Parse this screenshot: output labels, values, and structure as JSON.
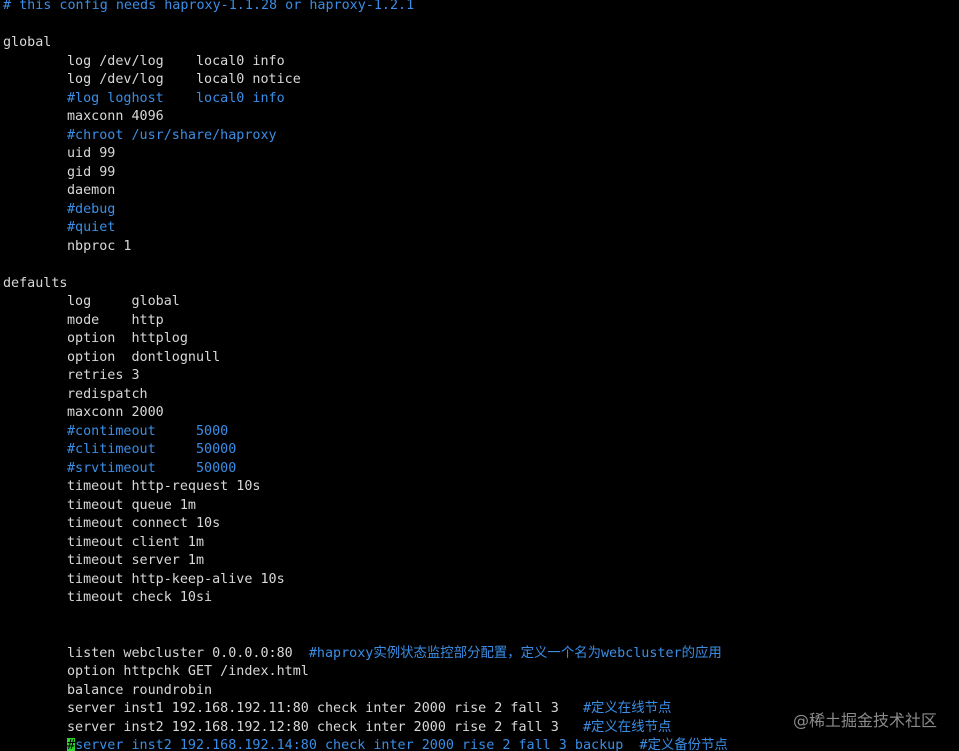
{
  "terminal": {
    "colors": {
      "background": "#000000",
      "text": "#d8d8d8",
      "comment": "#3a8ee6",
      "cursor": "#2fd32f"
    },
    "lines": [
      {
        "text": "# this config needs haproxy-1.1.28 or haproxy-1.2.1",
        "comment": "",
        "indent": 0
      },
      {
        "text": "",
        "comment": "",
        "indent": 0
      },
      {
        "text": "global",
        "comment": "",
        "indent": 0
      },
      {
        "text": "log /dev/log    local0 info",
        "comment": "",
        "indent": 1
      },
      {
        "text": "log /dev/log    local0 notice",
        "comment": "",
        "indent": 1
      },
      {
        "text": "#log loghost    local0 info",
        "comment": "",
        "indent": 1
      },
      {
        "text": "maxconn 4096",
        "comment": "",
        "indent": 1
      },
      {
        "text": "#chroot /usr/share/haproxy",
        "comment": "",
        "indent": 1
      },
      {
        "text": "uid 99",
        "comment": "",
        "indent": 1
      },
      {
        "text": "gid 99",
        "comment": "",
        "indent": 1
      },
      {
        "text": "daemon",
        "comment": "",
        "indent": 1
      },
      {
        "text": "#debug",
        "comment": "",
        "indent": 1
      },
      {
        "text": "#quiet",
        "comment": "",
        "indent": 1
      },
      {
        "text": "nbproc 1",
        "comment": "",
        "indent": 1
      },
      {
        "text": "",
        "comment": "",
        "indent": 0
      },
      {
        "text": "defaults",
        "comment": "",
        "indent": 0
      },
      {
        "text": "log     global",
        "comment": "",
        "indent": 1
      },
      {
        "text": "mode    http",
        "comment": "",
        "indent": 1
      },
      {
        "text": "option  httplog",
        "comment": "",
        "indent": 1
      },
      {
        "text": "option  dontlognull",
        "comment": "",
        "indent": 1
      },
      {
        "text": "retries 3",
        "comment": "",
        "indent": 1
      },
      {
        "text": "redispatch",
        "comment": "",
        "indent": 1
      },
      {
        "text": "maxconn 2000",
        "comment": "",
        "indent": 1
      },
      {
        "text": "#contimeout     5000",
        "comment": "",
        "indent": 1
      },
      {
        "text": "#clitimeout     50000",
        "comment": "",
        "indent": 1
      },
      {
        "text": "#srvtimeout     50000",
        "comment": "",
        "indent": 1
      },
      {
        "text": "timeout http-request 10s",
        "comment": "",
        "indent": 1
      },
      {
        "text": "timeout queue 1m",
        "comment": "",
        "indent": 1
      },
      {
        "text": "timeout connect 10s",
        "comment": "",
        "indent": 1
      },
      {
        "text": "timeout client 1m",
        "comment": "",
        "indent": 1
      },
      {
        "text": "timeout server 1m",
        "comment": "",
        "indent": 1
      },
      {
        "text": "timeout http-keep-alive 10s",
        "comment": "",
        "indent": 1
      },
      {
        "text": "timeout check 10si",
        "comment": "",
        "indent": 1
      },
      {
        "text": "",
        "comment": "",
        "indent": 0
      },
      {
        "text": "",
        "comment": "",
        "indent": 0
      },
      {
        "text": "listen webcluster 0.0.0.0:80  ",
        "comment": "#haproxy实例状态监控部分配置，定义一个名为webcluster的应用",
        "indent": 1
      },
      {
        "text": "option httpchk GET /index.html",
        "comment": "",
        "indent": 1
      },
      {
        "text": "balance roundrobin",
        "comment": "",
        "indent": 1
      },
      {
        "text": "server inst1 192.168.192.11:80 check inter 2000 rise 2 fall 3   ",
        "comment": "#定义在线节点",
        "indent": 1
      },
      {
        "text": "server inst2 192.168.192.12:80 check inter 2000 rise 2 fall 3   ",
        "comment": "#定义在线节点",
        "indent": 1
      },
      {
        "text": "#server inst2 192.168.192.14:80 check inter 2000 rise 2 fall 3 backup  #定义备份节点",
        "comment": "",
        "indent": 1,
        "cursor": true
      }
    ]
  },
  "watermark": "@稀土掘金技术社区"
}
